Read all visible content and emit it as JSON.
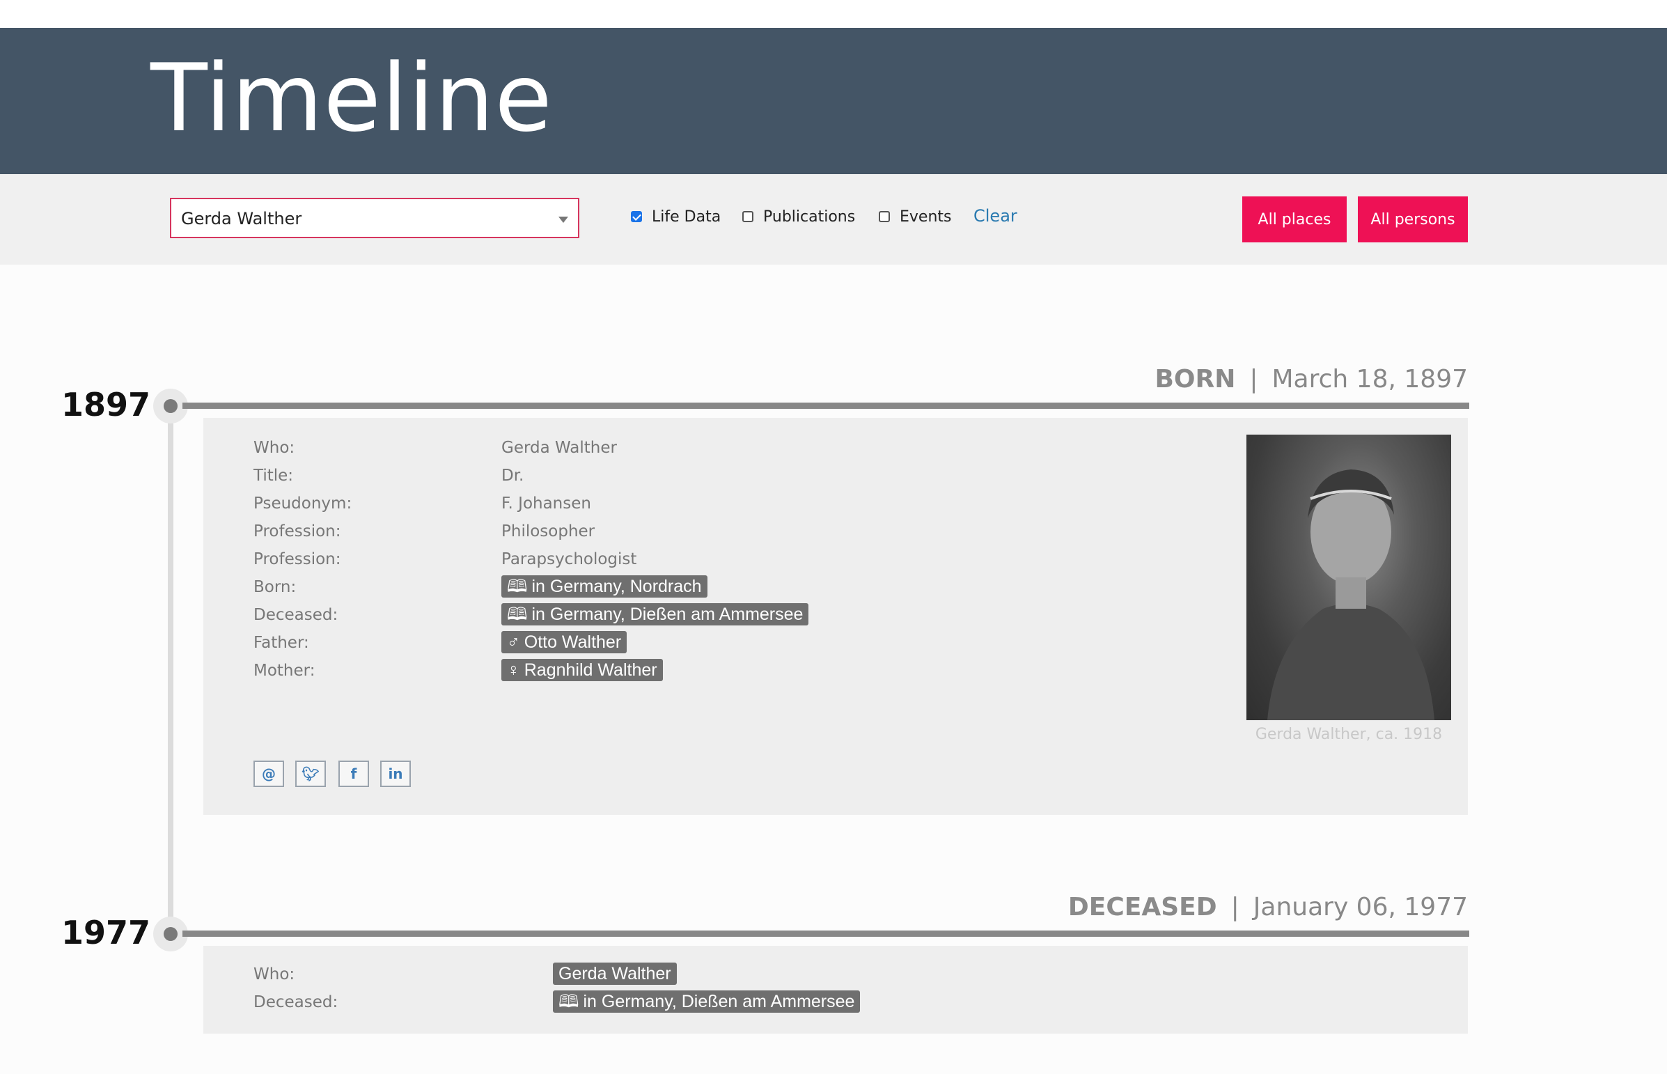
{
  "header": {
    "title": "Timeline"
  },
  "toolbar": {
    "person_select": {
      "value": "Gerda Walther"
    },
    "filters": [
      {
        "label": "Life Data",
        "checked": true
      },
      {
        "label": "Publications",
        "checked": false
      },
      {
        "label": "Events",
        "checked": false
      }
    ],
    "clear_label": "Clear",
    "all_places_label": "All places",
    "all_persons_label": "All persons"
  },
  "events": [
    {
      "year": "1897",
      "kind": "BORN",
      "separator": "|",
      "date": "March 18, 1897",
      "rows": [
        {
          "label": "Who:",
          "value": "Gerda Walther"
        },
        {
          "label": "Title:",
          "value": "Dr."
        },
        {
          "label": "Pseudonym:",
          "value": "F. Johansen"
        },
        {
          "label": "Profession:",
          "value": "Philosopher"
        },
        {
          "label": "Profession:",
          "value": "Parapsychologist"
        },
        {
          "label": "Born:",
          "value": "in Germany, Nordrach",
          "icon": "map-icon"
        },
        {
          "label": "Deceased:",
          "value": "in Germany, Dießen am Ammersee",
          "icon": "map-icon"
        },
        {
          "label": "Father:",
          "value": "Otto Walther",
          "icon": "male-icon"
        },
        {
          "label": "Mother:",
          "value": "Ragnhild Walther",
          "icon": "female-icon"
        }
      ],
      "photo_caption": "Gerda Walther, ca. 1918",
      "social": [
        "email-icon",
        "twitter-icon",
        "facebook-icon",
        "linkedin-icon"
      ]
    },
    {
      "year": "1977",
      "kind": "DECEASED",
      "separator": "|",
      "date": "January 06, 1977",
      "rows": [
        {
          "label": "Who:",
          "value": "Gerda Walther"
        },
        {
          "label": "Deceased:",
          "value": "in Germany, Dießen am Ammersee",
          "icon": "map-icon"
        }
      ]
    }
  ],
  "colors": {
    "header_bg": "#445566",
    "accent": "#ee1155",
    "link": "#2a7ab0",
    "tag_bg": "#6f6f6f"
  }
}
